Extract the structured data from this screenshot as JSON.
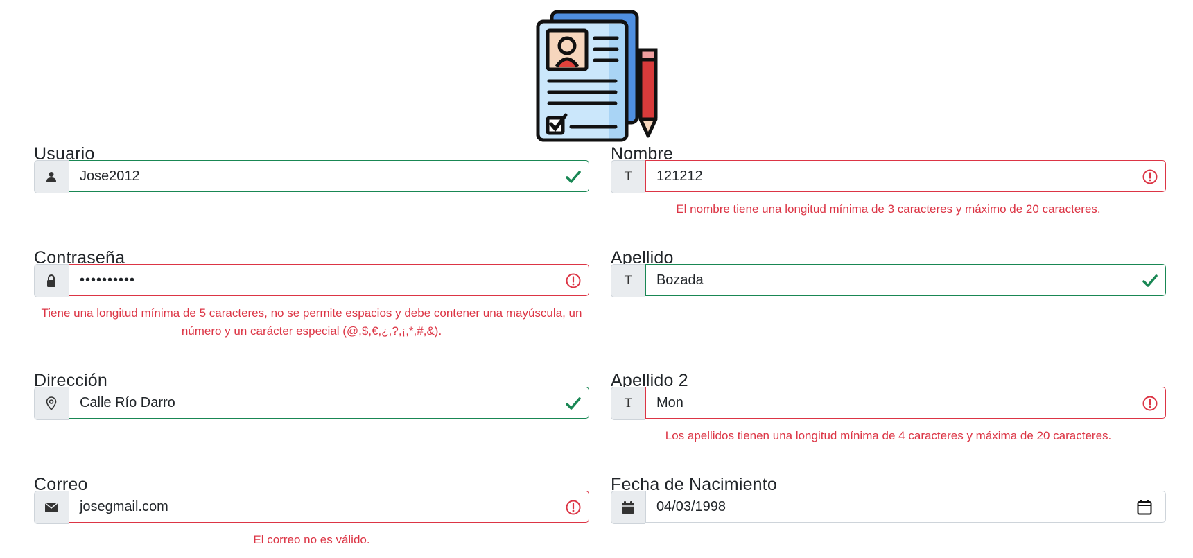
{
  "form": {
    "colors": {
      "valid": "#198754",
      "invalid": "#dc3545",
      "addon_bg": "#e9ecef"
    },
    "fields": {
      "usuario": {
        "label": "Usuario",
        "value": "Jose2012",
        "status": "valid",
        "icon": "user-icon"
      },
      "nombre": {
        "label": "Nombre",
        "value": "121212",
        "status": "invalid",
        "icon": "text-icon",
        "icon_glyph": "T",
        "error": "El nombre tiene una longitud mínima de 3 caracteres y máximo de 20 caracteres."
      },
      "password": {
        "label": "Contraseña",
        "value": "••••••••••",
        "status": "invalid",
        "icon": "lock-icon",
        "error_line1": "Tiene una longitud mínima de 5 caracteres, no se permite espacios y debe contener una mayúscula, un",
        "error_line2": "número y un carácter especial (@,$,€,¿,?,¡,*,#,&)."
      },
      "apellido": {
        "label": "Apellido",
        "value": "Bozada",
        "status": "valid",
        "icon": "text-icon",
        "icon_glyph": "T"
      },
      "direccion": {
        "label": "Dirección",
        "value": "Calle Río Darro",
        "status": "valid",
        "icon": "location-pin-icon"
      },
      "apellido2": {
        "label": "Apellido 2",
        "value": "Mon",
        "status": "invalid",
        "icon": "text-icon",
        "icon_glyph": "T",
        "error": "Los apellidos tienen una longitud mínima de 4 caracteres y máxima de 20 caracteres."
      },
      "correo": {
        "label": "Correo",
        "value": "josegmail.com",
        "status": "invalid",
        "icon": "envelope-icon",
        "error": "El correo no es válido."
      },
      "fecha": {
        "label": "Fecha de Nacimiento",
        "value": "04/03/1998",
        "status": "neutral",
        "icon": "calendar-icon"
      }
    }
  }
}
